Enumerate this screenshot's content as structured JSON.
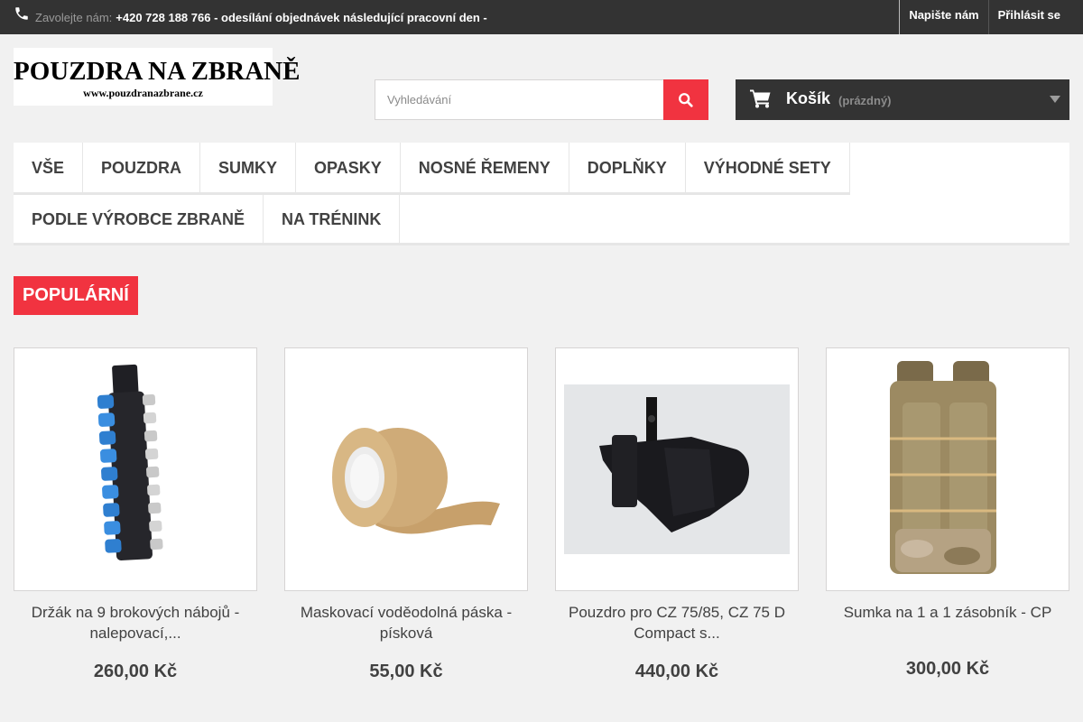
{
  "topbar": {
    "contact_label": "Zavolejte nám:",
    "contact_text": "+420 728 188 766 - odesílání objednávek následující pracovní den -",
    "links": [
      "Napište nám",
      "Přihlásit se"
    ]
  },
  "logo": {
    "title": "POUZDRA NA ZBRANĚ",
    "url": "www.pouzdranazbrane.cz"
  },
  "search": {
    "placeholder": "Vyhledávání"
  },
  "cart": {
    "title": "Košík",
    "state": "(prázdný)"
  },
  "menu": {
    "row1": [
      "Vše",
      "Pouzdra",
      "Sumky",
      "Opasky",
      "Nosné řemeny",
      "Doplňky",
      "Výhodné sety"
    ],
    "row2": [
      "Podle výrobce zbraně",
      "Na trénink"
    ]
  },
  "section": {
    "title": "POPULÁRNÍ"
  },
  "products": [
    {
      "name": "Držák na 9 brokových nábojů - nalepovací,...",
      "price": "260,00 Kč"
    },
    {
      "name": "Maskovací voděodolná páska - písková",
      "price": "55,00 Kč"
    },
    {
      "name": "Pouzdro pro CZ 75/85, CZ 75 D Compact s...",
      "price": "440,00 Kč"
    },
    {
      "name": "Sumka na 1 a 1 zásobník - CP",
      "price": "300,00 Kč"
    }
  ],
  "colors": {
    "accent": "#f13340",
    "dark": "#333333",
    "background": "#f1f1f1"
  }
}
